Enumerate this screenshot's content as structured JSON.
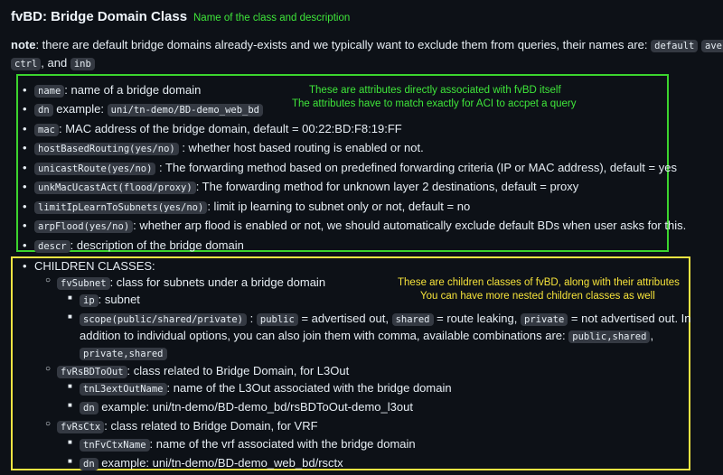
{
  "header": {
    "title": "fvBD: Bridge Domain Class",
    "annotation": "Name of the class and description"
  },
  "note": {
    "label": "note",
    "text": ": there are default bridge domains already-exists and we typically want to exclude them from queries, their names are: ",
    "code1": "default",
    "code2a": "ave-",
    "code2b": "ctrl",
    "sep": ", and ",
    "code3": "inb"
  },
  "attributes_annotation": {
    "line1": "These are attributes directly associated with fvBD itself",
    "line2": "The attributes have to match exactly for ACI to accpet a query"
  },
  "attributes": [
    {
      "code": "name",
      "text": ": name of a bridge domain"
    },
    {
      "code": "dn",
      "text": " example: ",
      "code2": "uni/tn-demo/BD-demo_web_bd"
    },
    {
      "code": "mac",
      "text": ": MAC address of the bridge domain, default = 00:22:BD:F8:19:FF"
    },
    {
      "code": "hostBasedRouting(yes/no)",
      "text": " : whether host based routing is enabled or not."
    },
    {
      "code": "unicastRoute(yes/no)",
      "text": " : The forwarding method based on predefined forwarding criteria (IP or MAC address), default = yes"
    },
    {
      "code": "unkMacUcastAct(flood/proxy)",
      "text": ": The forwarding method for unknown layer 2 destinations, default = proxy"
    },
    {
      "code": "limitIpLearnToSubnets(yes/no)",
      "text": ": limit ip learning to subnet only or not, default = no"
    },
    {
      "code": "arpFlood(yes/no)",
      "text": ": whether arp flood is enabled or not, we should automatically exclude default BDs when user asks for this."
    },
    {
      "code": "descr",
      "text": ": description of the bridge domain"
    }
  ],
  "children": {
    "heading": "CHILDREN CLASSES:",
    "annotation": {
      "line1": "These are children classes of fvBD, along with their attributes",
      "line2": "You can have more nested children classes as well"
    },
    "fvSubnet": {
      "code": "fvSubnet",
      "text": ": class for subnets under a bridge domain",
      "ip_code": "ip",
      "ip_text": ": subnet",
      "scope_code": "scope(public/shared/private)",
      "scope_sep": ":",
      "public_code": "public",
      "public_text": "= advertised out,",
      "shared_code": "shared",
      "shared_text": "= route leaking,",
      "private_code": "private",
      "private_text": "= not advertised out. In",
      "line2": "addition to individual options, you can also join them with comma, available combinations are:",
      "combo1_code": "public,shared",
      "combo_sep": ",",
      "combo2_code": "private,shared"
    },
    "fvRsBDToOut": {
      "code": "fvRsBDToOut",
      "text": ": class related to Bridge Domain, for L3Out",
      "attr1_code": "tnL3extOutName",
      "attr1_text": ": name of the L3Out associated with the bridge domain",
      "attr2_code": "dn",
      "attr2_text": "example: uni/tn-demo/BD-demo_bd/rsBDToOut-demo_l3out"
    },
    "fvRsCtx": {
      "code": "fvRsCtx",
      "text": ": class related to Bridge Domain, for VRF",
      "attr1_code": "tnFvCtxName",
      "attr1_text": ": name of the vrf associated with the bridge domain",
      "attr2_code": "dn",
      "attr2_text": "example: uni/tn-demo/BD-demo_web_bd/rsctx"
    }
  }
}
